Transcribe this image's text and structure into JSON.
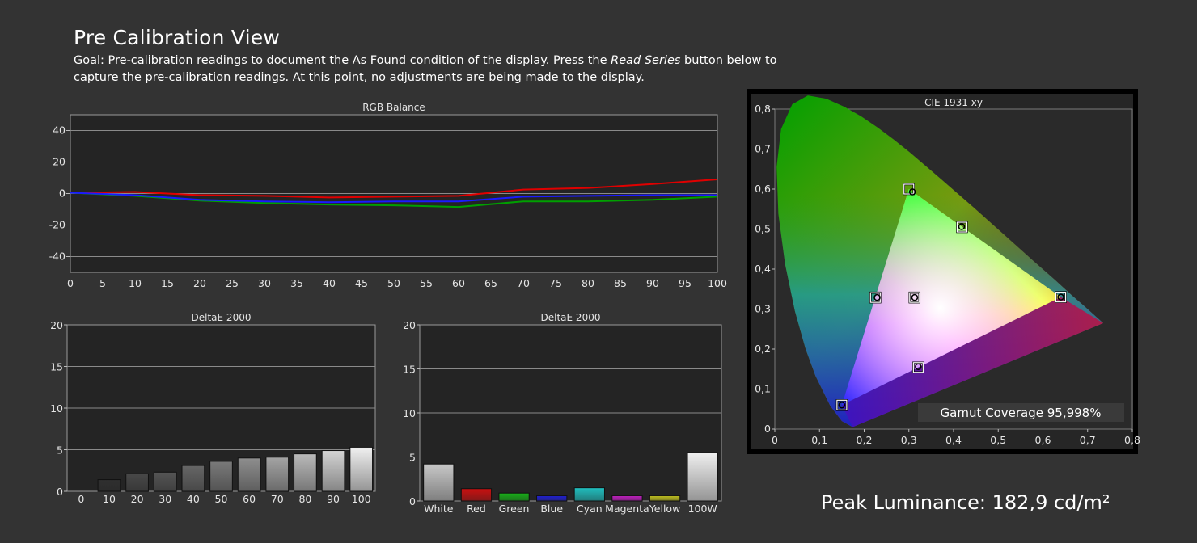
{
  "header": {
    "title": "Pre Calibration View",
    "goal_prefix": "Goal: Pre-calibration readings to document the As Found condition of the display. Press the ",
    "goal_emphasis": "Read Series",
    "goal_suffix": " button below to capture the pre-calibration readings. At this point, no adjustments are being made to the display."
  },
  "peak": {
    "text": "Peak Luminance: 182,9 cd/m²"
  },
  "gamut": {
    "text": "Gamut Coverage 95,998%"
  },
  "colors": {
    "background": "#333333",
    "plot_bg": "#242424",
    "grid": "#8a8a8a",
    "red": "#e00000",
    "green": "#00a000",
    "blue": "#1a1aff"
  },
  "chart_data": [
    {
      "type": "line",
      "title": "RGB Balance",
      "x": [
        0,
        10,
        20,
        30,
        40,
        50,
        60,
        70,
        80,
        90,
        100
      ],
      "xticks": [
        "0",
        "5",
        "10",
        "15",
        "20",
        "25",
        "30",
        "35",
        "40",
        "45",
        "50",
        "55",
        "60",
        "65",
        "70",
        "75",
        "80",
        "85",
        "90",
        "95",
        "100"
      ],
      "xlim": [
        0,
        100
      ],
      "ylim": [
        -50,
        50
      ],
      "yticks": [
        "-40",
        "-20",
        "0",
        "20",
        "40"
      ],
      "series": [
        {
          "color": "#e00000",
          "values": [
            0.5,
            1,
            -1,
            -1.5,
            -2.5,
            -2,
            -1.5,
            2.5,
            3.5,
            6,
            9
          ]
        },
        {
          "color": "#00a000",
          "values": [
            0.5,
            -1.5,
            -4.5,
            -6,
            -7,
            -7.5,
            -8.5,
            -5,
            -5,
            -4,
            -2
          ]
        },
        {
          "color": "#1a1aff",
          "values": [
            0.5,
            -1,
            -4,
            -5,
            -5.5,
            -5,
            -5,
            -2,
            -1.5,
            -1,
            -1
          ]
        }
      ],
      "grid": true
    },
    {
      "type": "bar",
      "title": "DeltaE 2000",
      "categories": [
        "0",
        "10",
        "20",
        "30",
        "40",
        "50",
        "60",
        "70",
        "80",
        "90",
        "100"
      ],
      "values": [
        0,
        1.4,
        2.1,
        2.3,
        3.1,
        3.6,
        4.0,
        4.1,
        4.5,
        4.9,
        5.3
      ],
      "bar_colors": [
        "#2a2a2a",
        "#303030",
        "#484848",
        "#555555",
        "#666666",
        "#7a7a7a",
        "#8e8e8e",
        "#a4a4a4",
        "#bababa",
        "#d4d4d4",
        "#f0f0f0"
      ],
      "ylim": [
        0,
        20
      ],
      "yticks": [
        "0",
        "5",
        "10",
        "15",
        "20"
      ],
      "grid": true
    },
    {
      "type": "bar",
      "title": "DeltaE 2000",
      "categories": [
        "White",
        "Red",
        "Green",
        "Blue",
        "Cyan",
        "Magenta",
        "Yellow",
        "100W"
      ],
      "values": [
        4.2,
        1.4,
        0.9,
        0.6,
        1.5,
        0.6,
        0.6,
        5.5
      ],
      "bar_colors": [
        "#c8c8c8",
        "#cc1010",
        "#18b018",
        "#2020d0",
        "#20c0c0",
        "#c020c0",
        "#c0c020",
        "#f0f0f0"
      ],
      "ylim": [
        0,
        20
      ],
      "yticks": [
        "0",
        "5",
        "10",
        "15",
        "20"
      ],
      "grid": true
    },
    {
      "type": "scatter",
      "title": "CIE 1931 xy",
      "xlim": [
        0,
        0.8
      ],
      "ylim": [
        0,
        0.8
      ],
      "xticks": [
        "0",
        "0,1",
        "0,2",
        "0,3",
        "0,4",
        "0,5",
        "0,6",
        "0,7",
        "0,8"
      ],
      "yticks": [
        "0",
        "0,1",
        "0,2",
        "0,3",
        "0,4",
        "0,5",
        "0,6",
        "0,7",
        "0,8"
      ],
      "gamut_triangle": [
        [
          0.64,
          0.33
        ],
        [
          0.3,
          0.6
        ],
        [
          0.15,
          0.06
        ]
      ],
      "targets": [
        [
          0.64,
          0.33
        ],
        [
          0.3,
          0.6
        ],
        [
          0.15,
          0.06
        ],
        [
          0.3127,
          0.329
        ],
        [
          0.225,
          0.329
        ],
        [
          0.321,
          0.154
        ],
        [
          0.419,
          0.505
        ]
      ],
      "measured": [
        [
          0.64,
          0.33
        ],
        [
          0.308,
          0.593
        ],
        [
          0.15,
          0.06
        ],
        [
          0.313,
          0.329
        ],
        [
          0.229,
          0.329
        ],
        [
          0.321,
          0.156
        ],
        [
          0.418,
          0.506
        ]
      ],
      "grid": false
    }
  ]
}
